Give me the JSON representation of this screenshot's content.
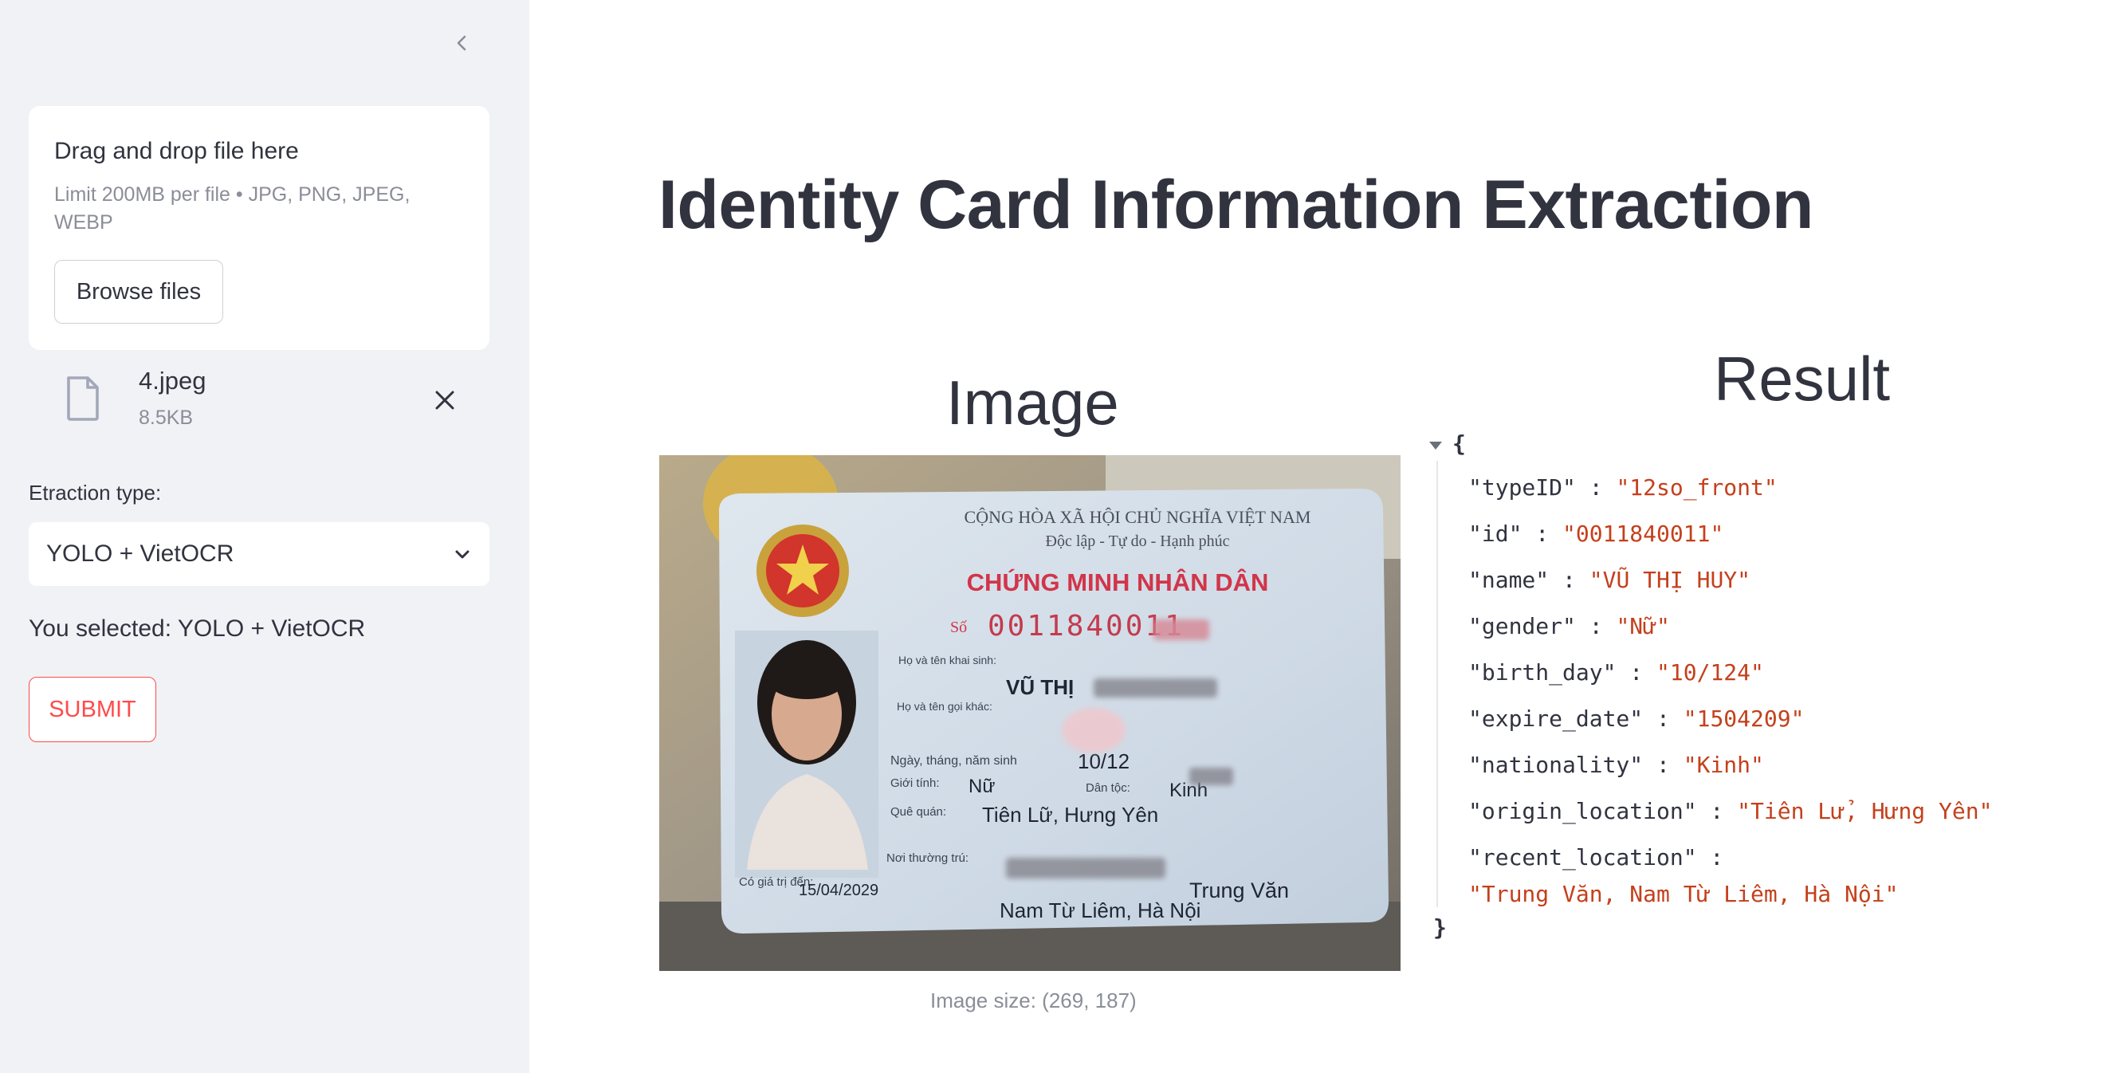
{
  "sidebar": {
    "uploader": {
      "drag_drop_label": "Drag and drop file here",
      "limit_text": "Limit 200MB per file • JPG, PNG, JPEG, WEBP",
      "browse_button": "Browse files"
    },
    "uploaded_file": {
      "name": "4.jpeg",
      "size": "8.5KB"
    },
    "extraction_type": {
      "label": "Etraction type:",
      "selected": "YOLO + VietOCR"
    },
    "selected_text": "You selected: YOLO + VietOCR",
    "submit_button": "SUBMIT"
  },
  "main": {
    "title": "Identity Card Information Extraction",
    "image_heading": "Image",
    "result_heading": "Result",
    "image_caption": "Image size: (269, 187)",
    "id_card": {
      "header_line1": "CỘNG HÒA XÃ HỘI CHỦ NGHĨA VIỆT NAM",
      "header_line2": "Độc lập - Tự do - Hạnh phúc",
      "card_title": "CHỨNG MINH NHÂN DÂN",
      "number_label": "Số",
      "number": "0011840011",
      "name_label": "Họ và tên khai sinh:",
      "name_value": "VŨ THỊ",
      "other_name_label": "Họ và tên gọi khác:",
      "dob_label": "Ngày, tháng, năm sinh",
      "dob_value": "10/12",
      "gender_label": "Giới tính:",
      "gender_value": "Nữ",
      "ethnic_label": "Dân tộc:",
      "ethnic_value": "Kinh",
      "hometown_label": "Quê quán:",
      "hometown_value": "Tiên Lữ, Hưng Yên",
      "residence_label": "Nơi thường trú:",
      "residence_line1": "Trung Văn",
      "residence_line2": "Nam Từ Liêm, Hà Nội",
      "valid_label": "Có giá trị đến:",
      "valid_value": "15/04/2029"
    },
    "result": {
      "open_brace": "{",
      "close_brace": "}",
      "fields": [
        {
          "key": "\"typeID\"",
          "value": "\"12so_front\""
        },
        {
          "key": "\"id\"",
          "value": "\"0011840011\""
        },
        {
          "key": "\"name\"",
          "value": "\"VŨ THỊ HUY\""
        },
        {
          "key": "\"gender\"",
          "value": "\"Nữ\""
        },
        {
          "key": "\"birth_day\"",
          "value": "\"10/124\""
        },
        {
          "key": "\"expire_date\"",
          "value": "\"1504209\""
        },
        {
          "key": "\"nationality\"",
          "value": "\"Kinh\""
        },
        {
          "key": "\"origin_location\"",
          "value": "\"Tiên Lử, Hưng Yên\""
        },
        {
          "key": "\"recent_location\"",
          "value": "\"Trung Văn, Nam Từ Liêm, Hà Nội\""
        }
      ]
    }
  },
  "colors": {
    "sidebar_bg": "#f0f2f6",
    "text": "#31333f",
    "muted": "#8b8d98",
    "accent_red": "#ff4b4b",
    "json_value": "#c4401c"
  },
  "icons": {
    "collapse": "chevron-left-icon",
    "file": "file-icon",
    "remove": "close-icon",
    "dropdown": "chevron-down-icon",
    "json_toggle": "triangle-down-icon"
  }
}
